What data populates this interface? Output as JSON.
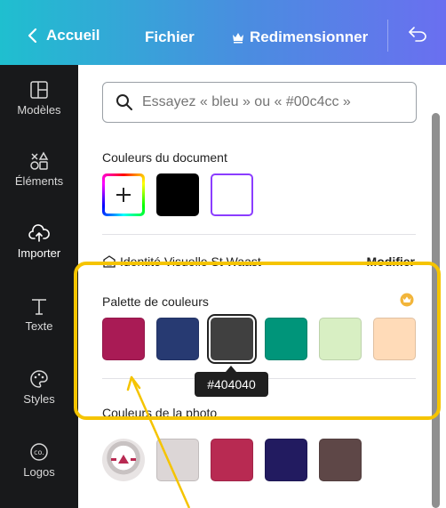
{
  "topbar": {
    "back_label": "Accueil",
    "file_label": "Fichier",
    "resize_label": "Redimensionner"
  },
  "sidebar": {
    "items": [
      {
        "label": "Modèles",
        "icon": "layout-icon"
      },
      {
        "label": "Éléments",
        "icon": "shapes-icon"
      },
      {
        "label": "Importer",
        "icon": "cloud-upload-icon"
      },
      {
        "label": "Texte",
        "icon": "text-icon"
      },
      {
        "label": "Styles",
        "icon": "palette-icon"
      },
      {
        "label": "Logos",
        "icon": "logo-icon"
      }
    ]
  },
  "search": {
    "placeholder": "Essayez « bleu » ou « #00c4cc »"
  },
  "document_colors": {
    "title": "Couleurs du document",
    "colors": [
      "#000000",
      "#ffffff"
    ],
    "selected_border": "#8b3dff"
  },
  "brand_kit": {
    "name": "Identité Visuelle St Waast",
    "edit_label": "Modifier"
  },
  "palette": {
    "title": "Palette de couleurs",
    "colors": [
      "#a91b55",
      "#273a72",
      "#404040",
      "#00957a",
      "#d8efc3",
      "#ffdbb8"
    ],
    "tooltip": "#404040"
  },
  "photo_colors": {
    "title": "Couleurs de la photo",
    "colors": [
      "#dcd6d6",
      "#b82a52",
      "#221b60",
      "#5e4747"
    ]
  },
  "annotation_color": "#f5c400"
}
